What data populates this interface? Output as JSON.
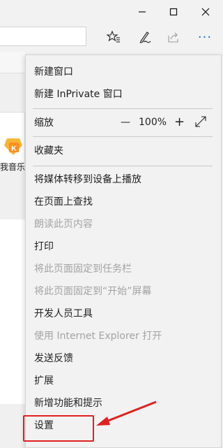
{
  "window": {
    "minimize_icon": "minimize-icon",
    "maximize_icon": "maximize-icon",
    "close_icon": "close-icon"
  },
  "toolbar": {
    "favorites_icon": "favorites-star-icon",
    "notes_icon": "pen-icon",
    "share_icon": "share-icon",
    "more_label": "···"
  },
  "page": {
    "tile_label": "我音乐"
  },
  "menu": {
    "items": [
      {
        "label": "新建窗口",
        "enabled": true
      },
      {
        "label": "新建 InPrivate 窗口",
        "enabled": true
      },
      {
        "label": "缩放",
        "enabled": true
      },
      {
        "label": "收藏夹",
        "enabled": true
      },
      {
        "label": "将媒体转移到设备上播放",
        "enabled": true
      },
      {
        "label": "在页面上查找",
        "enabled": true
      },
      {
        "label": "朗读此页内容",
        "enabled": false
      },
      {
        "label": "打印",
        "enabled": true
      },
      {
        "label": "将此页面固定到任务栏",
        "enabled": false
      },
      {
        "label": "将此页面固定到“开始”屏幕",
        "enabled": false
      },
      {
        "label": "开发人员工具",
        "enabled": true
      },
      {
        "label": "使用 Internet Explorer 打开",
        "enabled": false
      },
      {
        "label": "发送反馈",
        "enabled": true
      },
      {
        "label": "扩展",
        "enabled": true
      },
      {
        "label": "新增功能和提示",
        "enabled": true
      },
      {
        "label": "设置",
        "enabled": true
      }
    ],
    "zoom": {
      "minus": "—",
      "value": "100%",
      "plus": "+",
      "fullscreen_icon": "expand-diagonal-icon"
    }
  },
  "annotation": {
    "color": "#e02020"
  }
}
